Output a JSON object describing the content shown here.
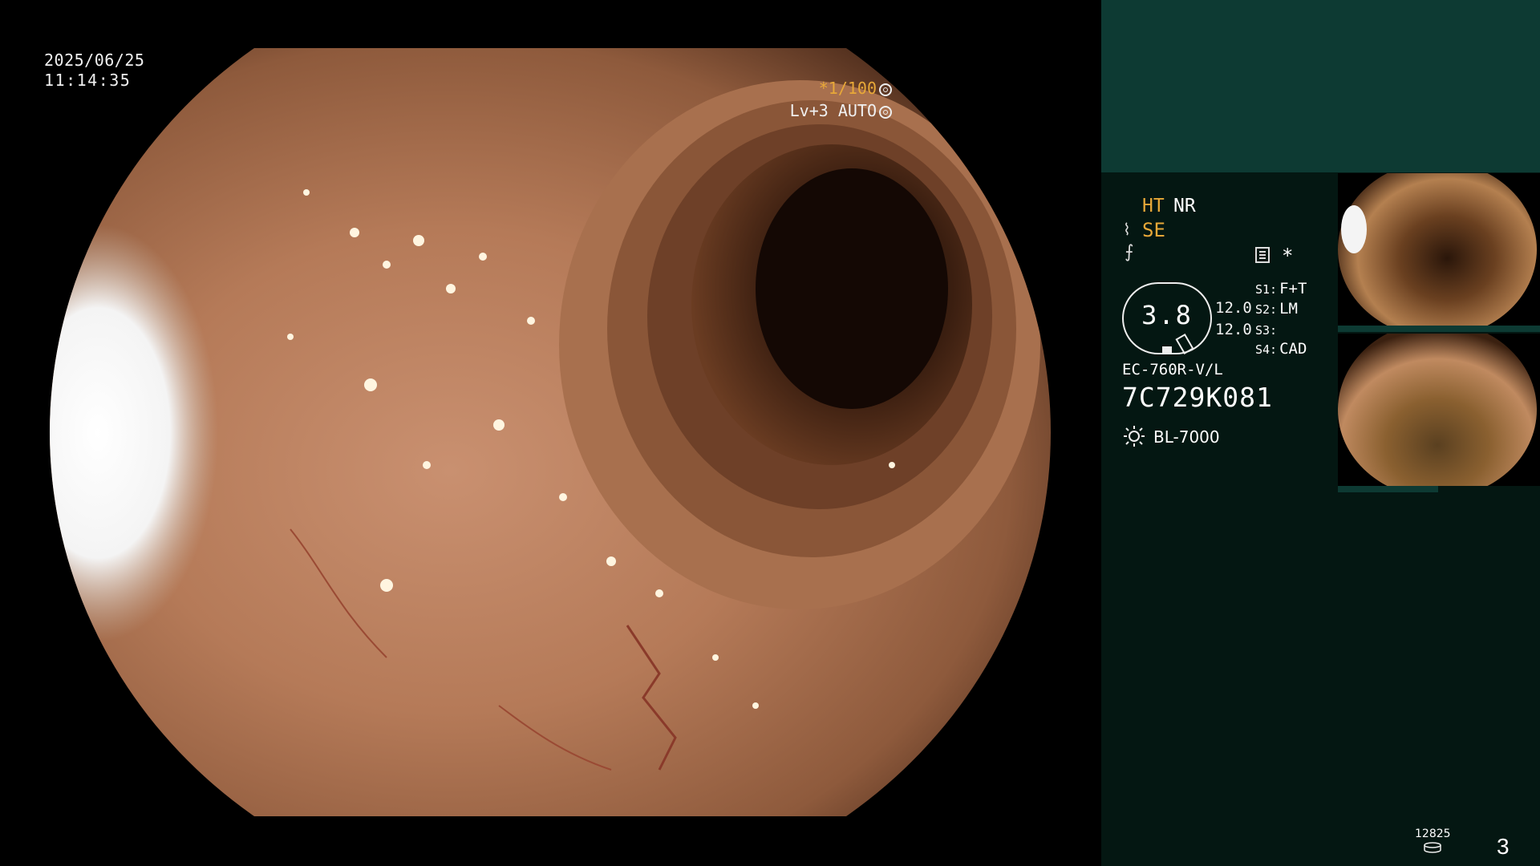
{
  "overlay": {
    "date": "2025/06/25",
    "time": "11:14:35",
    "shutter_prefix": "*1/100",
    "level": "Lv+3 AUTO"
  },
  "panel": {
    "ht": "HT",
    "nr": "NR",
    "se": "SE",
    "star": "*",
    "dial_value": "3.8",
    "value_1": "12.0",
    "value_2": "12.0",
    "switches": [
      {
        "key": "S1:",
        "value": "F+T"
      },
      {
        "key": "S2:",
        "value": "LM"
      },
      {
        "key": "S3:",
        "value": ""
      },
      {
        "key": "S4:",
        "value": "CAD"
      }
    ],
    "scope_model": "EC-760R-V/L",
    "scope_serial": "7C729K081",
    "light_source": "BL-7000",
    "counter": "12825",
    "page_number": "3"
  },
  "colors": {
    "accent": "#e8a838",
    "panel_bg": "#041712",
    "panel_top": "#0d3a33"
  },
  "icons": [
    "sun-icon",
    "settings-icon",
    "document-icon",
    "disk-icon",
    "se-icon",
    "filter-icon"
  ]
}
